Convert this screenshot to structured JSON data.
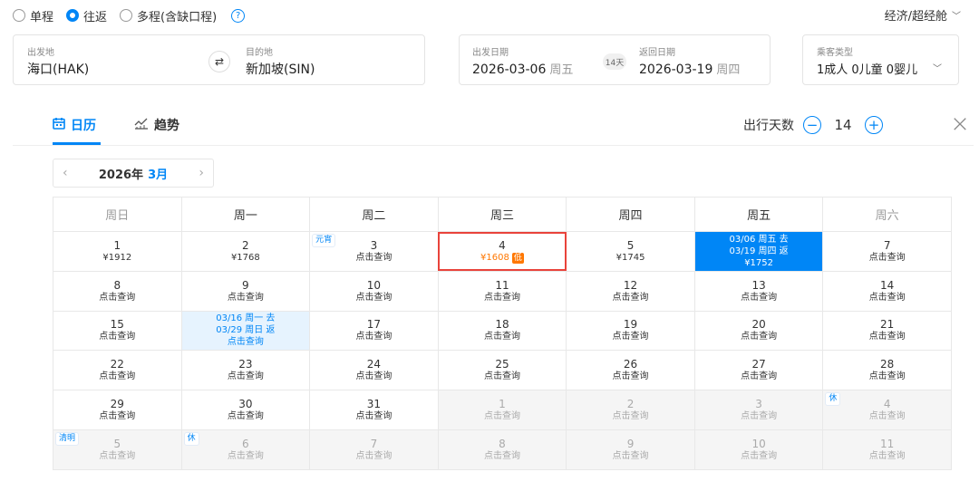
{
  "trip_types": [
    {
      "label": "单程",
      "selected": false
    },
    {
      "label": "往返",
      "selected": true
    },
    {
      "label": "多程(含缺口程)",
      "selected": false
    }
  ],
  "help_icon": "?",
  "cabin_class": "经济/超经舱",
  "origin": {
    "label": "出发地",
    "value": "海口(HAK)"
  },
  "destination": {
    "label": "目的地",
    "value": "新加坡(SIN)"
  },
  "depart": {
    "label": "出发日期",
    "date": "2026-03-06",
    "weekday": "周五"
  },
  "return": {
    "label": "返回日期",
    "date": "2026-03-19",
    "weekday": "周四"
  },
  "trip_days": "14天",
  "passengers": {
    "label": "乘客类型",
    "value": "1成人  0儿童  0婴儿"
  },
  "tabs": [
    {
      "label": "日历",
      "icon": "calendar-icon",
      "active": true
    },
    {
      "label": "趋势",
      "icon": "trend-chart-icon",
      "active": false
    }
  ],
  "duration": {
    "label": "出行天数",
    "value": "14",
    "minus": "−",
    "plus": "+"
  },
  "close": "×",
  "month_nav": {
    "prev": "‹",
    "year": "2026年",
    "month": "3月",
    "next": "›"
  },
  "weekdays": [
    "周日",
    "周一",
    "周二",
    "周三",
    "周四",
    "周五",
    "周六"
  ],
  "calendar": [
    [
      {
        "day": "1",
        "sub": [
          "¥1912"
        ]
      },
      {
        "day": "2",
        "sub": [
          "¥1768"
        ]
      },
      {
        "day": "3",
        "sub": [
          "点击查询"
        ],
        "tag": "元宵"
      },
      {
        "day": "4",
        "sub": [
          "¥1608"
        ],
        "low": "低",
        "state": "lowcell"
      },
      {
        "day": "5",
        "sub": [
          "¥1745"
        ]
      },
      {
        "day": "",
        "sub": [
          "03/06 周五 去",
          "03/19 周四 返",
          "¥1752"
        ],
        "state": "sel"
      },
      {
        "day": "7",
        "sub": [
          "点击查询"
        ]
      }
    ],
    [
      {
        "day": "8",
        "sub": [
          "点击查询"
        ]
      },
      {
        "day": "9",
        "sub": [
          "点击查询"
        ]
      },
      {
        "day": "10",
        "sub": [
          "点击查询"
        ]
      },
      {
        "day": "11",
        "sub": [
          "点击查询"
        ]
      },
      {
        "day": "12",
        "sub": [
          "点击查询"
        ]
      },
      {
        "day": "13",
        "sub": [
          "点击查询"
        ]
      },
      {
        "day": "14",
        "sub": [
          "点击查询"
        ]
      }
    ],
    [
      {
        "day": "15",
        "sub": [
          "点击查询"
        ]
      },
      {
        "day": "",
        "sub": [
          "03/16 周一 去",
          "03/29 周日 返",
          "点击查询"
        ],
        "state": "hl"
      },
      {
        "day": "17",
        "sub": [
          "点击查询"
        ]
      },
      {
        "day": "18",
        "sub": [
          "点击查询"
        ]
      },
      {
        "day": "19",
        "sub": [
          "点击查询"
        ]
      },
      {
        "day": "20",
        "sub": [
          "点击查询"
        ]
      },
      {
        "day": "21",
        "sub": [
          "点击查询"
        ]
      }
    ],
    [
      {
        "day": "22",
        "sub": [
          "点击查询"
        ]
      },
      {
        "day": "23",
        "sub": [
          "点击查询"
        ]
      },
      {
        "day": "24",
        "sub": [
          "点击查询"
        ]
      },
      {
        "day": "25",
        "sub": [
          "点击查询"
        ]
      },
      {
        "day": "26",
        "sub": [
          "点击查询"
        ]
      },
      {
        "day": "27",
        "sub": [
          "点击查询"
        ]
      },
      {
        "day": "28",
        "sub": [
          "点击查询"
        ]
      }
    ],
    [
      {
        "day": "29",
        "sub": [
          "点击查询"
        ]
      },
      {
        "day": "30",
        "sub": [
          "点击查询"
        ]
      },
      {
        "day": "31",
        "sub": [
          "点击查询"
        ]
      },
      {
        "day": "1",
        "sub": [
          "点击查询"
        ],
        "state": "other"
      },
      {
        "day": "2",
        "sub": [
          "点击查询"
        ],
        "state": "other"
      },
      {
        "day": "3",
        "sub": [
          "点击查询"
        ],
        "state": "other"
      },
      {
        "day": "4",
        "sub": [
          "点击查询"
        ],
        "state": "other",
        "tag": "休"
      }
    ],
    [
      {
        "day": "5",
        "sub": [
          "点击查询"
        ],
        "state": "other",
        "tag": "清明"
      },
      {
        "day": "6",
        "sub": [
          "点击查询"
        ],
        "state": "other",
        "tag": "休"
      },
      {
        "day": "7",
        "sub": [
          "点击查询"
        ],
        "state": "other"
      },
      {
        "day": "8",
        "sub": [
          "点击查询"
        ],
        "state": "other"
      },
      {
        "day": "9",
        "sub": [
          "点击查询"
        ],
        "state": "other"
      },
      {
        "day": "10",
        "sub": [
          "点击查询"
        ],
        "state": "other"
      },
      {
        "day": "11",
        "sub": [
          "点击查询"
        ],
        "state": "other"
      }
    ]
  ],
  "colors": {
    "accent": "#0086f6",
    "low_price": "#ff7700",
    "highlight_border": "#e9433b"
  }
}
